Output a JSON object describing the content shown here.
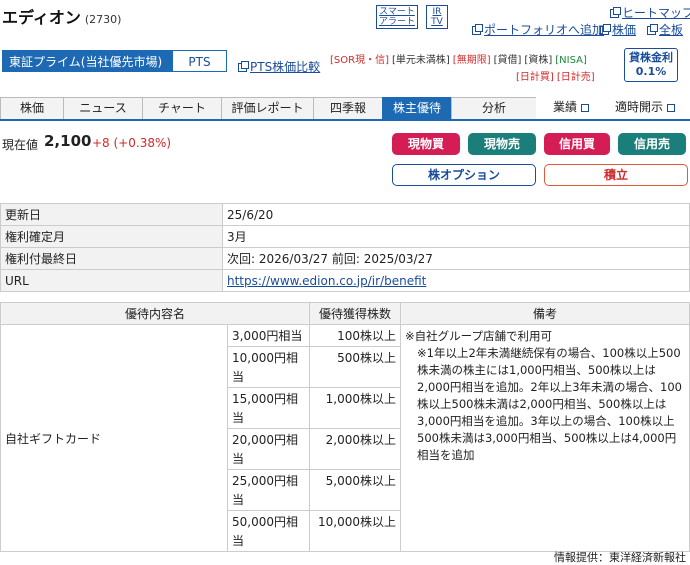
{
  "header": {
    "company_name": "エディオン",
    "code": "(2730)",
    "smart_alert_line1": "スマート",
    "smart_alert_line2": "アラート",
    "irtv_line1": "IR",
    "irtv_line2": "TV",
    "heatmap": "ヒートマップ",
    "portfolio_add": "ポートフォリオへ追加",
    "stock_price": "株価",
    "all_board": "全板",
    "market_tab": "東証プライム(当社優先市場)",
    "pts_tab": "PTS",
    "pts_compare": "PTS株価比較",
    "badges_row1": [
      "[SOR現・信]",
      "[単元未満株]",
      "[無期限]",
      "[貸借]",
      "[資株]",
      "[NISA]"
    ],
    "badges_row2": [
      "[日計買]",
      "[日計売]"
    ],
    "lending_line1": "貸株金利",
    "lending_line2": "0.1%"
  },
  "tabs": [
    {
      "label": "株価",
      "active": false,
      "external": false
    },
    {
      "label": "ニュース",
      "active": false,
      "external": false
    },
    {
      "label": "チャート",
      "active": false,
      "external": false
    },
    {
      "label": "評価レポート",
      "active": false,
      "external": false
    },
    {
      "label": "四季報",
      "active": false,
      "external": false
    },
    {
      "label": "株主優待",
      "active": true,
      "external": false
    },
    {
      "label": "分析",
      "active": false,
      "external": false
    },
    {
      "label": "業績",
      "active": false,
      "external": true
    },
    {
      "label": "適時開示",
      "active": false,
      "external": true
    }
  ],
  "price": {
    "label": "現在値",
    "value": "2,100",
    "change": "+8 (+0.38%)"
  },
  "trade_buttons": {
    "spot_buy": "現物買",
    "spot_sell": "現物売",
    "margin_buy": "信用買",
    "margin_sell": "信用売",
    "options": "株オプション",
    "accumulate": "積立"
  },
  "info": {
    "rows": [
      {
        "label": "更新日",
        "value": "25/6/20"
      },
      {
        "label": "権利確定月",
        "value": "3月"
      },
      {
        "label": "権利付最終日",
        "value": "次回: 2026/03/27 前回: 2025/03/27"
      },
      {
        "label": "URL",
        "value": "https://www.edion.co.jp/ir/benefit"
      }
    ]
  },
  "perks": {
    "headers": [
      "優待内容名",
      "優待獲得株数",
      "備考"
    ],
    "name": "自社ギフトカード",
    "tiers": [
      {
        "value": "3,000円相当",
        "shares": "100株以上"
      },
      {
        "value": "10,000円相当",
        "shares": "500株以上"
      },
      {
        "value": "15,000円相当",
        "shares": "1,000株以上"
      },
      {
        "value": "20,000円相当",
        "shares": "2,000株以上"
      },
      {
        "value": "25,000円相当",
        "shares": "5,000株以上"
      },
      {
        "value": "50,000円相当",
        "shares": "10,000株以上"
      }
    ],
    "note_line1": "※自社グループ店舗で利用可",
    "note_line2": "※1年以上2年未満継続保有の場合、100株以上500株未満の株主には1,000円相当、500株以上は2,000円相当を追加。2年以上3年未満の場合、100株以上500株未満は2,000円相当、500株以上は3,000円相当を追加。3年以上の場合、100株以上500株未満は3,000円相当、500株以上は4,000円相当を追加"
  },
  "credit": "情報提供：東洋経済新報社"
}
